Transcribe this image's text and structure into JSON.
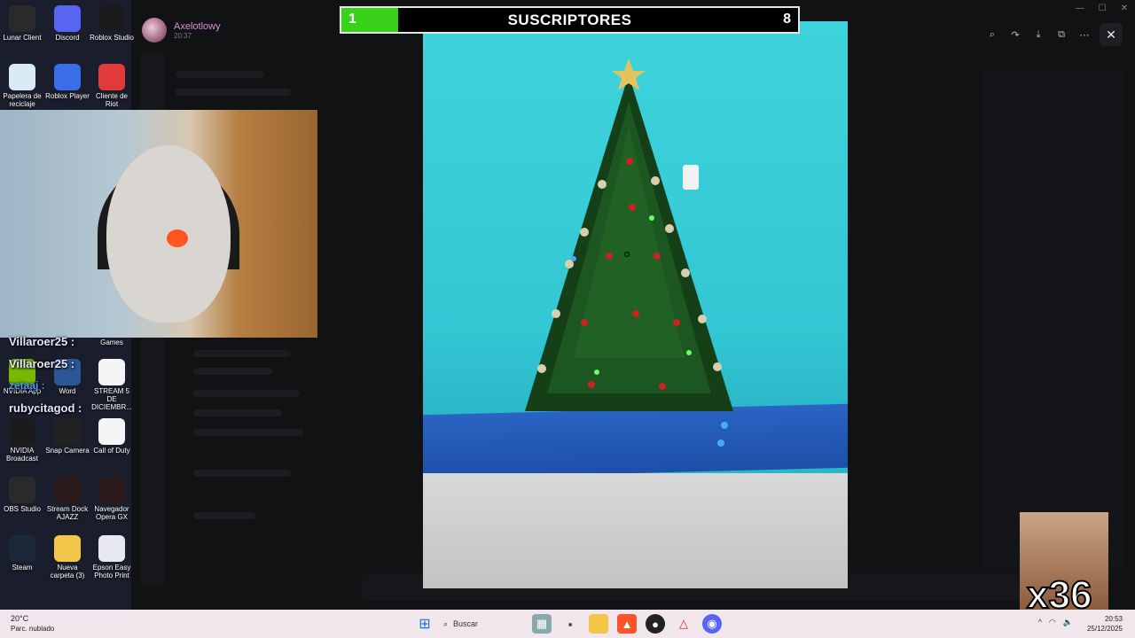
{
  "desktop": {
    "icons": [
      {
        "label": "Lunar Client",
        "icon": "lunar-icon",
        "color": "#2a2a2a"
      },
      {
        "label": "Discord",
        "icon": "discord-icon",
        "color": "#5865f2"
      },
      {
        "label": "Roblox Studio",
        "icon": "roblox-icon",
        "color": "#1b1b1b"
      },
      {
        "label": "Papelera de reciclaje",
        "icon": "recycle-bin-icon",
        "color": "#d9ecf5"
      },
      {
        "label": "Roblox Player",
        "icon": "roblox-player-icon",
        "color": "#3a6ee8"
      },
      {
        "label": "Cliente de Riot",
        "icon": "riot-icon",
        "color": "#e23a3a"
      },
      {
        "label": "NVIDIA App",
        "icon": "nvidia-icon",
        "color": "#76b900"
      },
      {
        "label": "Word",
        "icon": "word-icon",
        "color": "#2b5797"
      },
      {
        "label": "STREAM 5 DE DICIEMBR...",
        "icon": "document-icon",
        "color": "#f5f5f5"
      },
      {
        "label": "NVIDIA Broadcast",
        "icon": "nvidia-broadcast-icon",
        "color": "#1b1b1b"
      },
      {
        "label": "Snap Camera",
        "icon": "snap-camera-icon",
        "color": "#222"
      },
      {
        "label": "Call of Duty",
        "icon": "call-of-duty-icon",
        "color": "#f5f5f5"
      },
      {
        "label": "OBS Studio",
        "icon": "obs-icon",
        "color": "#2a2a2a"
      },
      {
        "label": "Stream Dock AJAZZ",
        "icon": "stream-dock-icon",
        "color": "#2a1a1a"
      },
      {
        "label": "Navegador Opera GX",
        "icon": "opera-gx-icon",
        "color": "#2a1a1a"
      },
      {
        "label": "Steam",
        "icon": "steam-icon",
        "color": "#1b2838"
      },
      {
        "label": "Nueva carpeta (3)",
        "icon": "folder-icon",
        "color": "#f3c64a"
      },
      {
        "label": "Epson Easy Photo Print",
        "icon": "epson-icon",
        "color": "#e8e8f0"
      }
    ],
    "games_label": "Games"
  },
  "discord": {
    "username": "Axelotlowy",
    "time": "20:37"
  },
  "subscriber_goal": {
    "current": "1",
    "title": "SUSCRIPTORES",
    "goal": "8",
    "progress_fraction": 0.125,
    "fill_color": "#39d11a"
  },
  "chat": [
    {
      "user": "Villaroer25 :"
    },
    {
      "user": "Villaroer25 :"
    },
    {
      "user": "zetaaj :"
    },
    {
      "user": "rubycitagod :"
    }
  ],
  "meme": {
    "count": "x36"
  },
  "viewer_tools": [
    "zoom-icon",
    "forward-icon",
    "download-icon",
    "open-external-icon",
    "more-icon",
    "close-icon"
  ],
  "taskbar": {
    "temperature": "20°C",
    "weather": "Parc. nublado",
    "search_placeholder": "Buscar",
    "time": "20:53",
    "date": "25/12/2025"
  }
}
